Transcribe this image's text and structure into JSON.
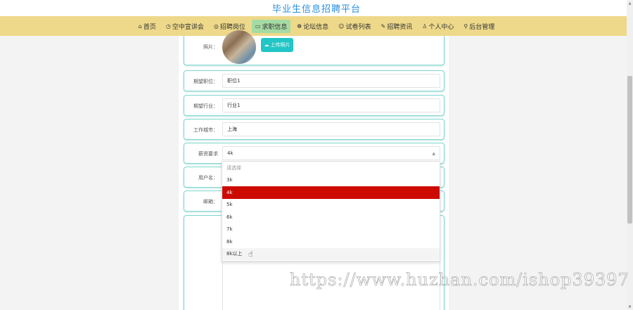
{
  "site": {
    "title": "毕业生信息招聘平台"
  },
  "nav": {
    "items": [
      {
        "icon": "⌂",
        "label": "首页",
        "active": false,
        "name": "home"
      },
      {
        "icon": "◷",
        "label": "空中宣讲会",
        "active": false,
        "name": "online-talks"
      },
      {
        "icon": "◎",
        "label": "招聘岗位",
        "active": false,
        "name": "job-posts"
      },
      {
        "icon": "▭",
        "label": "求职信息",
        "active": true,
        "name": "job-seeking"
      },
      {
        "icon": "❁",
        "label": "论坛信息",
        "active": false,
        "name": "forum"
      },
      {
        "icon": "☺",
        "label": "试卷列表",
        "active": false,
        "name": "exam-list"
      },
      {
        "icon": "✎",
        "label": "招聘资讯",
        "active": false,
        "name": "recruit-news"
      },
      {
        "icon": "♙",
        "label": "个人中心",
        "active": false,
        "name": "user-center"
      },
      {
        "icon": "⚲",
        "label": "后台管理",
        "active": false,
        "name": "admin"
      }
    ]
  },
  "form": {
    "photo": {
      "label": "照片：",
      "upload_label": "上传照片",
      "upload_icon": "☁"
    },
    "expected_position": {
      "label": "期望职位：",
      "value": "职位1"
    },
    "expected_industry": {
      "label": "期望行业：",
      "value": "行业1"
    },
    "work_city": {
      "label": "工作城市：",
      "value": "上海"
    },
    "salary": {
      "label": "薪资要求",
      "value": "4k",
      "caret": "▲"
    },
    "username": {
      "label": "用户名："
    },
    "email": {
      "label": "邮箱："
    }
  },
  "dropdown": {
    "options": [
      {
        "label": "请选择",
        "state": "placeholder"
      },
      {
        "label": "3k",
        "state": ""
      },
      {
        "label": "4k",
        "state": "selected"
      },
      {
        "label": "5k",
        "state": ""
      },
      {
        "label": "6k",
        "state": ""
      },
      {
        "label": "7k",
        "state": ""
      },
      {
        "label": "8k",
        "state": ""
      },
      {
        "label": "8k以上",
        "state": "hover"
      }
    ]
  },
  "watermark": "https://www.huzhan.com/ishop39397",
  "colors": {
    "title_blue": "#2a8fdc",
    "nav_bg": "#eed98a",
    "nav_active": "#a5dba3",
    "border_teal": "#7fd6cf",
    "upload_btn": "#21c6c6",
    "selected_red": "#cc0a00"
  }
}
